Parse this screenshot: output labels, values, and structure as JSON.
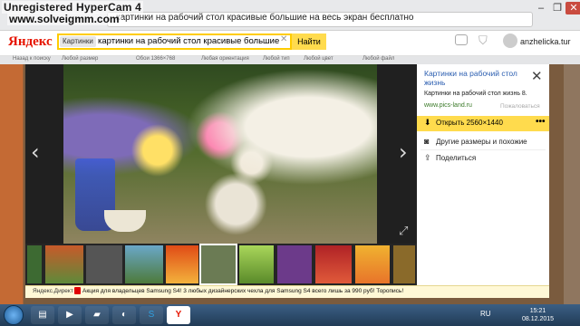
{
  "recorder": {
    "watermark": "Unregistered HyperCam 4",
    "site": "www.solveigmm.com"
  },
  "browser": {
    "tab_text": "картинки на рабочий стол красивые большие на весь экран бесплатно",
    "window_controls": [
      "minimize-icon",
      "restore-icon",
      "close-icon"
    ]
  },
  "header": {
    "logo": "Яндекс",
    "search_chip": "Картинки",
    "query": "картинки на рабочий стол красивые большие на ве",
    "clear_icon": "close-icon",
    "find_label": "Найти",
    "user": "anzhelicka.tur"
  },
  "filters": [
    "Назад к поиску",
    "Любой размер",
    "Обои 1366×768",
    "Любая ориентация",
    "Любой тип",
    "Любой цвет",
    "Любой файл"
  ],
  "viewer": {
    "prev_icon": "chevron-left-icon",
    "next_icon": "chevron-right-icon",
    "expand_icon": "expand-icon"
  },
  "thumbs": {
    "count_visible": 11
  },
  "panel": {
    "title": "Картинки на рабочий стол жизнь",
    "subtitle": "Картинки на рабочий стол жизнь 8.",
    "url": "www.pics-land.ru",
    "complain": "Пожаловаться",
    "open_label": "Открыть 2560×1440",
    "open_more": "•••",
    "sizes_label": "Другие размеры и похожие",
    "share_label": "Поделиться"
  },
  "ad": {
    "label": "Яндекс.Директ",
    "text": "Акция для владельцев Samsung S4! 3 любых дизайнерских чехла для Samsung S4 всего лишь за 990 руб! Торопись!"
  },
  "taskbar": {
    "lang": "RU",
    "time": "15:21",
    "date": "08.12.2015"
  },
  "colors": {
    "yandex_red": "#e61400",
    "accent_yellow": "#ffdb4d",
    "link_blue": "#2a5db0",
    "url_green": "#3a7a28"
  }
}
